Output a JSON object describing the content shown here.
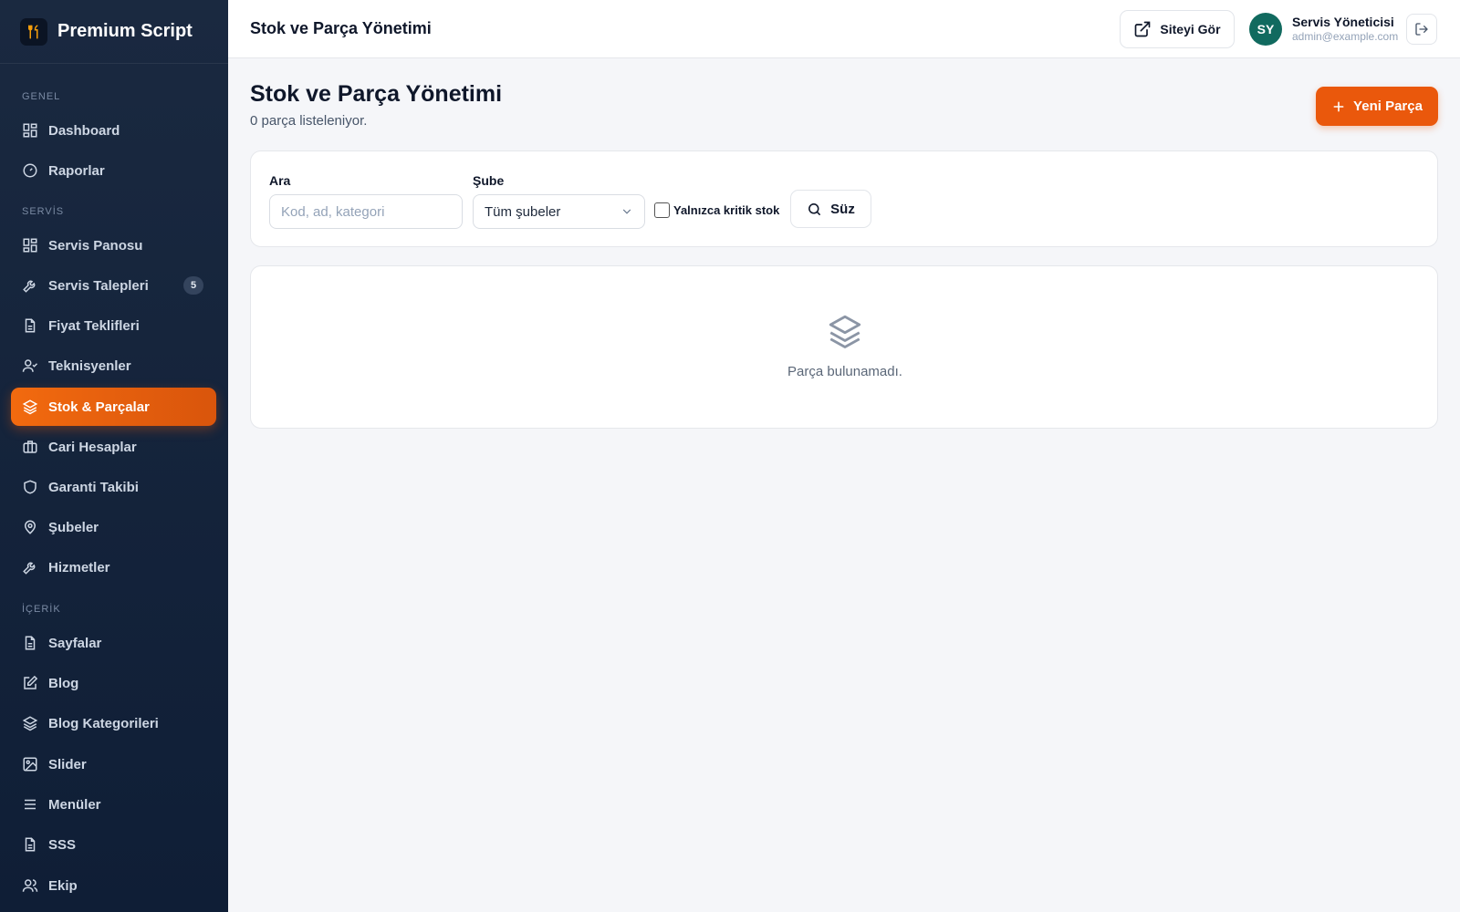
{
  "app": {
    "brand_name": "Premium Script",
    "logo_icon": "tools-icon"
  },
  "sidebar": {
    "sections": {
      "general": "GENEL",
      "service": "SERVİS",
      "content": "İÇERİK"
    },
    "items": [
      {
        "label": "Dashboard",
        "icon": "grid-icon"
      },
      {
        "label": "Raporlar",
        "icon": "gauge-icon"
      },
      {
        "label": "Servis Panosu",
        "icon": "grid-icon"
      },
      {
        "label": "Servis Talepleri",
        "icon": "wrench-icon",
        "badge": "5"
      },
      {
        "label": "Fiyat Teklifleri",
        "icon": "document-icon"
      },
      {
        "label": "Teknisyenler",
        "icon": "user-check-icon"
      },
      {
        "label": "Stok & Parçalar",
        "icon": "layers-icon",
        "active": true
      },
      {
        "label": "Cari Hesaplar",
        "icon": "briefcase-icon"
      },
      {
        "label": "Garanti Takibi",
        "icon": "shield-icon"
      },
      {
        "label": "Şubeler",
        "icon": "map-pin-icon"
      },
      {
        "label": "Hizmetler",
        "icon": "wrench-icon"
      },
      {
        "label": "Sayfalar",
        "icon": "document-icon"
      },
      {
        "label": "Blog",
        "icon": "edit-icon"
      },
      {
        "label": "Blog Kategorileri",
        "icon": "layers-icon"
      },
      {
        "label": "Slider",
        "icon": "image-icon"
      },
      {
        "label": "Menüler",
        "icon": "menu-icon"
      },
      {
        "label": "SSS",
        "icon": "document-icon"
      },
      {
        "label": "Ekip",
        "icon": "users-icon"
      }
    ]
  },
  "topbar": {
    "title": "Stok ve Parça Yönetimi",
    "site_button": "Siteyi Gör",
    "user": {
      "initials": "SY",
      "name": "Servis Yöneticisi",
      "email": "admin@example.com"
    }
  },
  "page": {
    "title": "Stok ve Parça Yönetimi",
    "subtitle": "0 parça listeleniyor.",
    "new_button": "Yeni Parça"
  },
  "filters": {
    "search_label": "Ara",
    "search_placeholder": "Kod, ad, kategori",
    "search_value": "",
    "branch_label": "Şube",
    "branch_selected": "Tüm şubeler",
    "critical_label": "Yalnızca kritik stok",
    "critical_checked": false,
    "filter_button": "Süz"
  },
  "empty": {
    "message": "Parça bulunamadı.",
    "icon": "layers-icon"
  },
  "colors": {
    "accent": "#ea580c",
    "sidebar_bg": "#13233b",
    "avatar_bg": "#116a5f"
  }
}
